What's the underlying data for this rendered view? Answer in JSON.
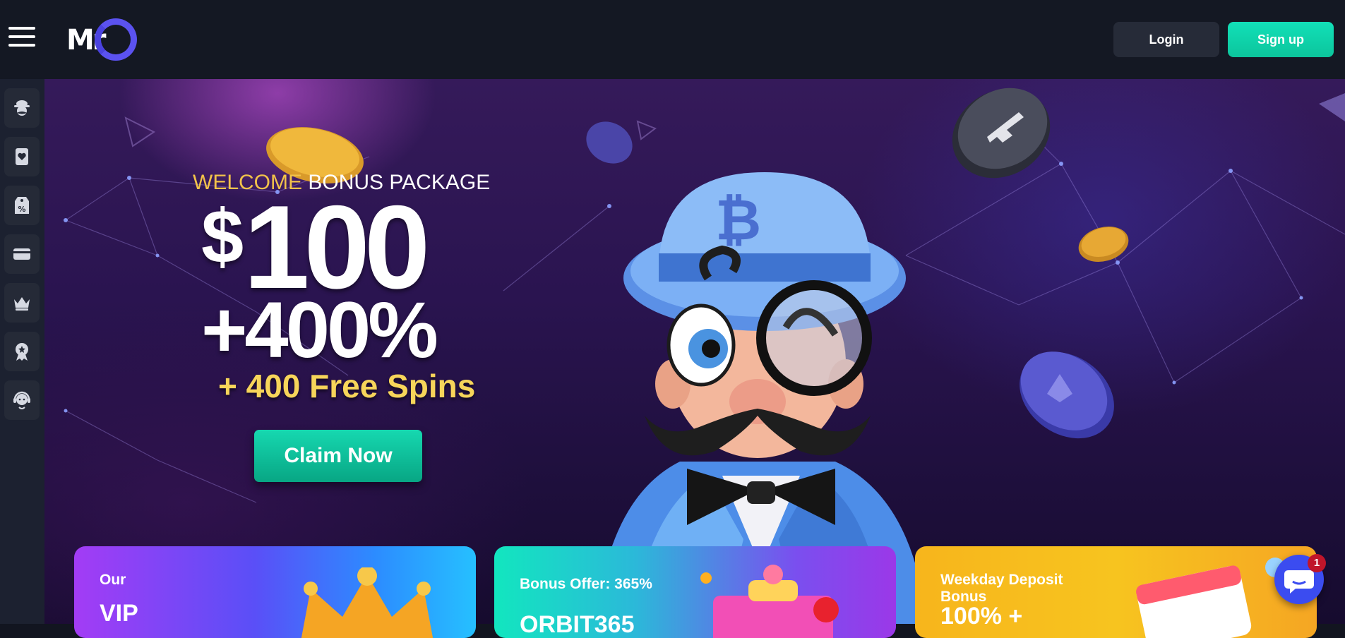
{
  "header": {
    "logo_text": "Mr",
    "login_label": "Login",
    "signup_label": "Sign up"
  },
  "sidebar": {
    "items": [
      {
        "icon": "mr-o-avatar-icon"
      },
      {
        "icon": "playing-card-icon"
      },
      {
        "icon": "promotion-tag-icon"
      },
      {
        "icon": "credit-card-icon"
      },
      {
        "icon": "crown-icon"
      },
      {
        "icon": "award-badge-icon"
      },
      {
        "icon": "support-agent-icon"
      }
    ]
  },
  "hero": {
    "welcome_word": "WELCOME",
    "bonus_package": "BONUS PACKAGE",
    "dollar_sign": "$",
    "amount": "100",
    "percent": "+400%",
    "free_spins": "+ 400 Free Spins",
    "cta_label": "Claim Now"
  },
  "promos": [
    {
      "small": "Our",
      "big": "VIP"
    },
    {
      "small": "Bonus Offer: 365%",
      "big": "ORBIT365"
    },
    {
      "small": "Weekday Deposit",
      "small2": "Bonus",
      "big": "100% +"
    }
  ],
  "chat": {
    "badge_count": "1"
  },
  "colors": {
    "accent_green": "#12e0b8",
    "accent_gold": "#f7d55a",
    "welcome_gold": "#f2c24a",
    "brand_blue": "#5b52f0"
  }
}
